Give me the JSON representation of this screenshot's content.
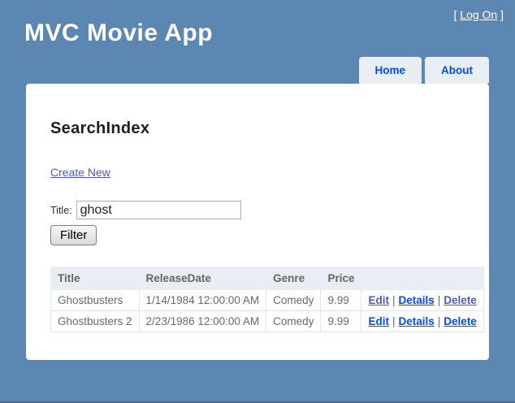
{
  "header": {
    "app_title": "MVC Movie App",
    "login": {
      "prefix": "[ ",
      "link_label": "Log On",
      "suffix": " ]"
    },
    "nav": [
      {
        "label": "Home"
      },
      {
        "label": "About"
      }
    ]
  },
  "main": {
    "heading": "SearchIndex",
    "create_link": "Create New",
    "filter_form": {
      "label": "Title:",
      "input_value": "ghost",
      "button_label": "Filter"
    },
    "table": {
      "headers": [
        "Title",
        "ReleaseDate",
        "Genre",
        "Price",
        ""
      ],
      "action_separator": "|",
      "rows": [
        {
          "title": "Ghostbusters",
          "release_date": "1/14/1984 12:00:00 AM",
          "genre": "Comedy",
          "price": "9.99",
          "actions": [
            "Edit",
            "Details",
            "Delete"
          ]
        },
        {
          "title": "Ghostbusters 2",
          "release_date": "2/23/1986 12:00:00 AM",
          "genre": "Comedy",
          "price": "9.99",
          "actions": [
            "Edit",
            "Details",
            "Delete"
          ]
        }
      ]
    }
  },
  "colors": {
    "page_background": "#5c87b2",
    "panel_background": "#ffffff",
    "tab_background": "#e8eef4",
    "table_header_background": "#e8eef4",
    "link": "#034af3",
    "link_visited": "#505abc",
    "header_text": "#ffffff"
  }
}
